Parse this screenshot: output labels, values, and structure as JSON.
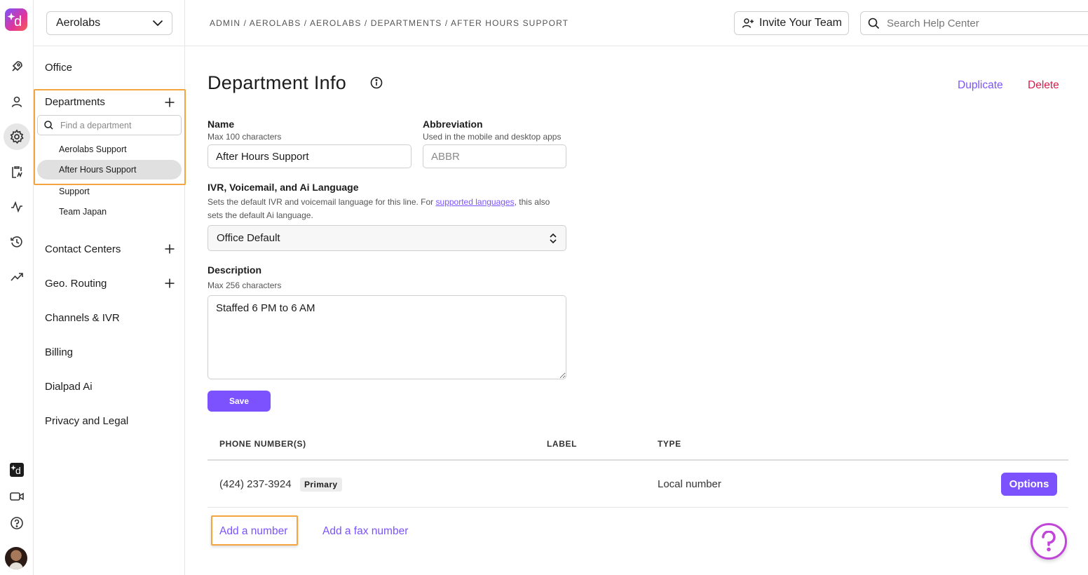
{
  "org_select": {
    "value": "Aerolabs"
  },
  "sidebar": {
    "office": "Office",
    "departments": {
      "label": "Departments",
      "search_placeholder": "Find a department",
      "items": [
        "Aerolabs Support",
        "After Hours Support",
        "Support",
        "Team Japan"
      ],
      "selected": "After Hours Support"
    },
    "contact_centers": "Contact Centers",
    "geo_routing": "Geo. Routing",
    "channels_ivr": "Channels & IVR",
    "billing": "Billing",
    "dialpad_ai": "Dialpad Ai",
    "privacy_legal": "Privacy and Legal"
  },
  "header": {
    "breadcrumb": "ADMIN / AEROLABS / AEROLABS / DEPARTMENTS / AFTER HOURS SUPPORT",
    "invite_label": "Invite Your Team",
    "search_placeholder": "Search Help Center"
  },
  "main": {
    "title": "Department Info",
    "duplicate": "Duplicate",
    "delete": "Delete",
    "name": {
      "label": "Name",
      "hint": "Max 100 characters",
      "value": "After Hours Support"
    },
    "abbreviation": {
      "label": "Abbreviation",
      "hint": "Used in the mobile and desktop apps",
      "placeholder": "ABBR"
    },
    "language": {
      "label": "IVR, Voicemail, and Ai Language",
      "hint_before": "Sets the default IVR and voicemail language for this line. For ",
      "hint_link": "supported languages",
      "hint_after": ", this also sets the default Ai language.",
      "value": "Office Default"
    },
    "description": {
      "label": "Description",
      "hint": "Max 256 characters",
      "value": "Staffed 6 PM to 6 AM"
    },
    "save": "Save"
  },
  "numbers_table": {
    "headers": [
      "PHONE NUMBER(S)",
      "LABEL",
      "TYPE"
    ],
    "rows": [
      {
        "number": "(424) 237-3924",
        "badge": "Primary",
        "label": "",
        "type": "Local number",
        "action": "Options"
      }
    ],
    "add_number": "Add a number",
    "add_fax": "Add a fax number"
  },
  "colors": {
    "accent": "#7c52ff",
    "danger": "#d81b4b",
    "highlight": "#f5a540"
  }
}
